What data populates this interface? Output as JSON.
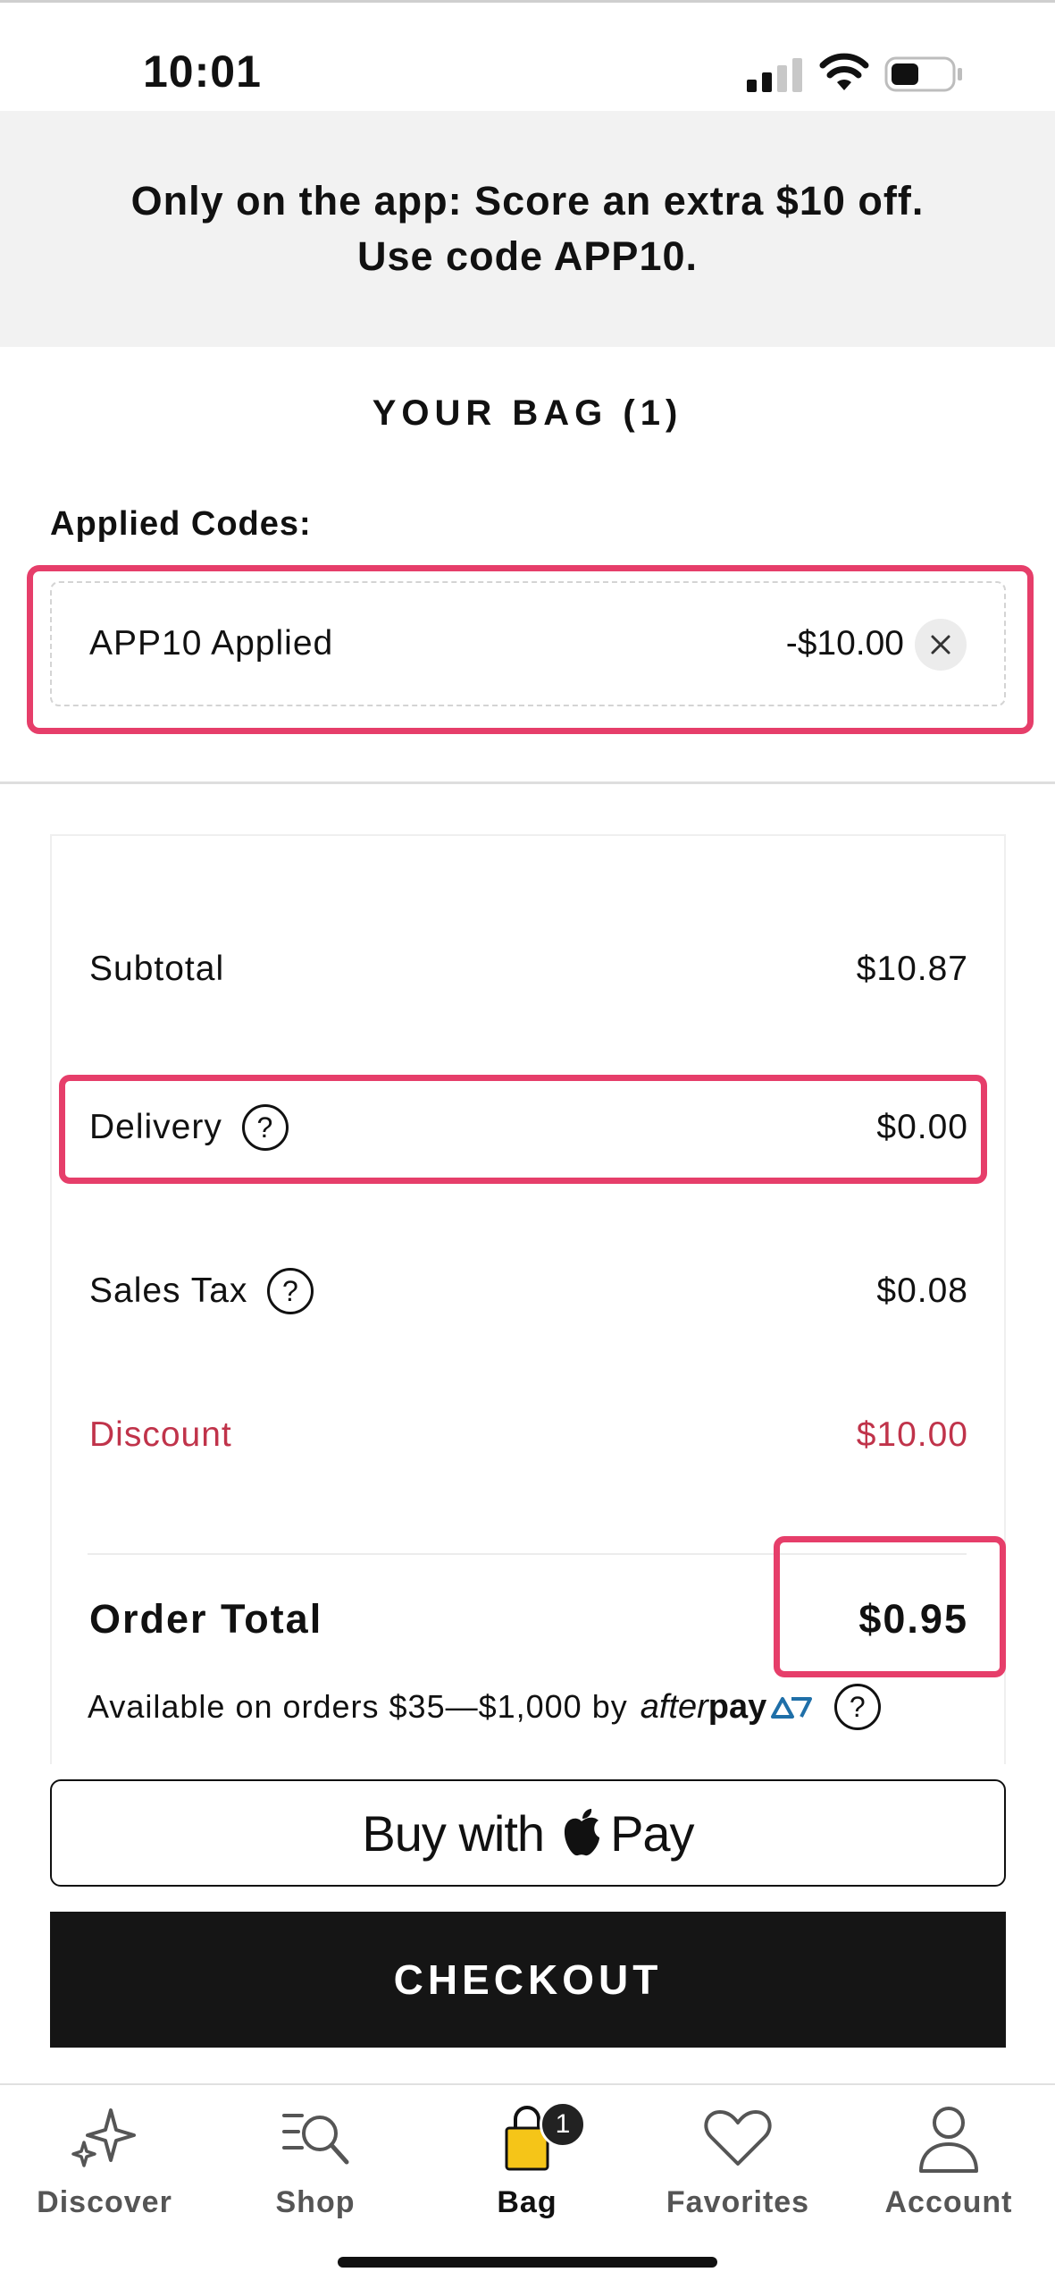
{
  "status_bar": {
    "time": "10:01"
  },
  "promo": {
    "line1": "Only on the app: Score an extra $10 off.",
    "line2": "Use code APP10."
  },
  "bag": {
    "title": "YOUR BAG (1)",
    "applied_codes_label": "Applied Codes:",
    "code": {
      "label": "APP10 Applied",
      "amount": "-$10.00"
    }
  },
  "summary": {
    "subtotal": {
      "label": "Subtotal",
      "value": "$10.87"
    },
    "delivery": {
      "label": "Delivery",
      "value": "$0.00"
    },
    "sales_tax": {
      "label": "Sales Tax",
      "value": "$0.08"
    },
    "discount": {
      "label": "Discount",
      "value": "$10.00",
      "color": "#c0334a"
    },
    "total": {
      "label": "Order Total",
      "value": "$0.95"
    },
    "help_glyph": "?"
  },
  "afterpay": {
    "text": "Available on orders $35—$1,000 by",
    "logo_light": "after",
    "logo_bold": "pay"
  },
  "buttons": {
    "applepay_prefix": "Buy with",
    "applepay_suffix": "Pay",
    "checkout": "CHECKOUT"
  },
  "tabs": [
    {
      "label": "Discover",
      "icon": "sparkle-icon"
    },
    {
      "label": "Shop",
      "icon": "search-list-icon"
    },
    {
      "label": "Bag",
      "icon": "bag-icon",
      "badge": "1",
      "active": true
    },
    {
      "label": "Favorites",
      "icon": "heart-icon"
    },
    {
      "label": "Account",
      "icon": "person-icon"
    }
  ],
  "colors": {
    "highlight": "#e63e6a",
    "bag_icon": "#f5c518",
    "afterpay_accent": "#1f6fa8"
  }
}
